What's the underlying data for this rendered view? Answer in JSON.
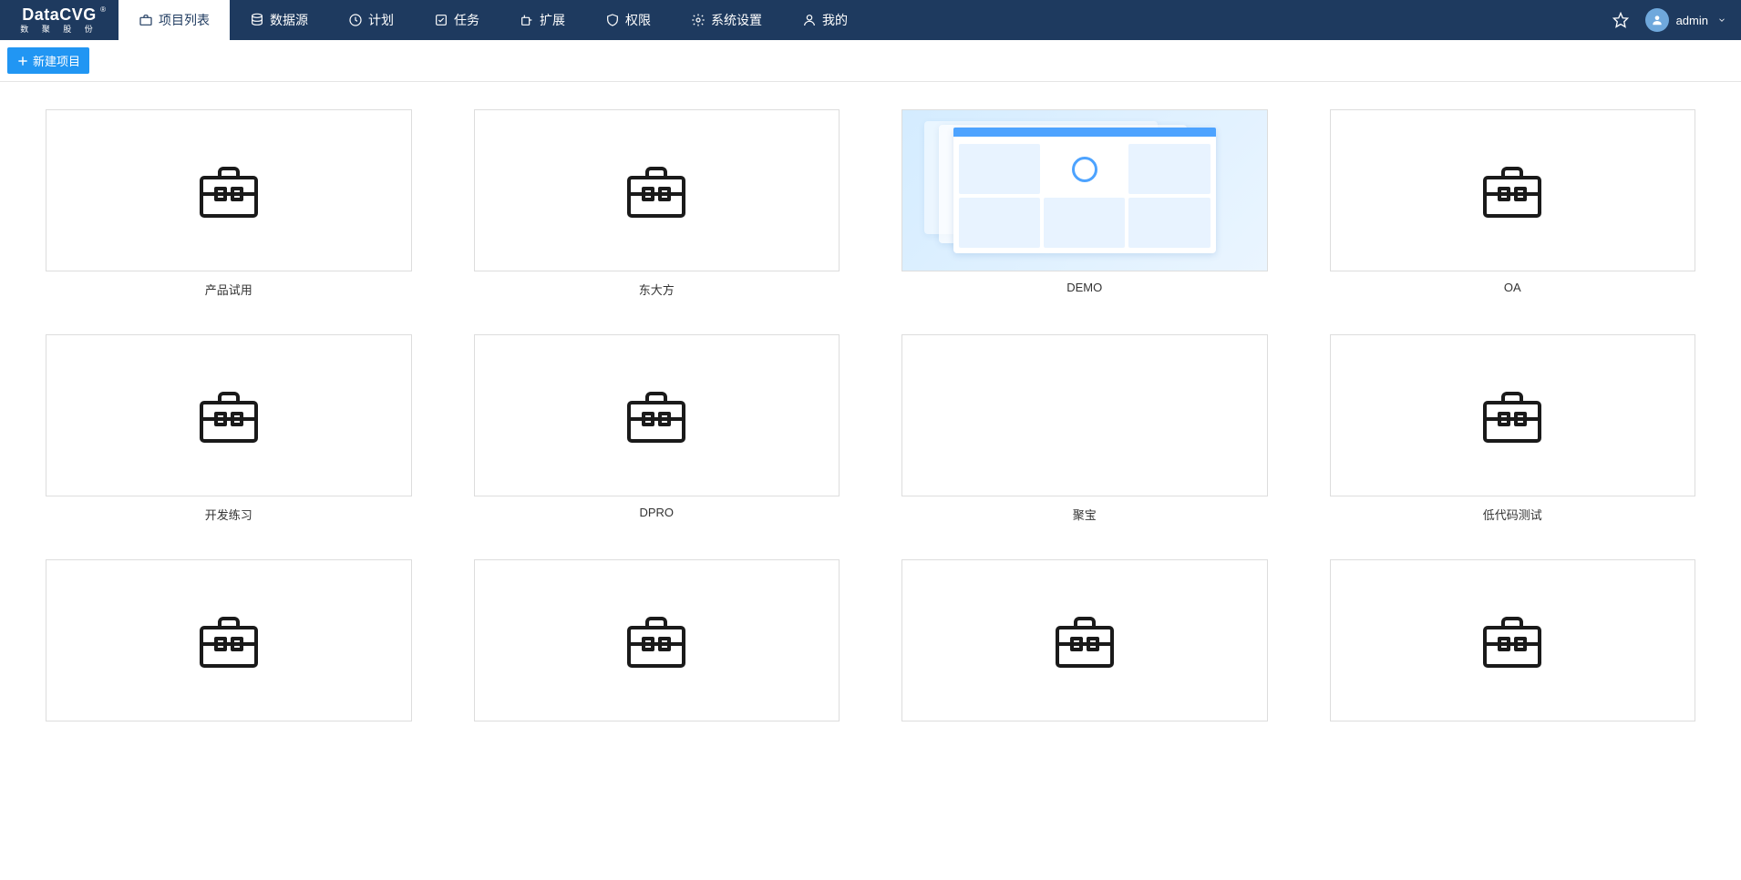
{
  "logo": {
    "main": "DataCVG",
    "sub": "数 聚 股 份",
    "reg": "®"
  },
  "nav": [
    {
      "label": "项目列表",
      "icon": "briefcase-icon",
      "active": true
    },
    {
      "label": "数据源",
      "icon": "database-icon",
      "active": false
    },
    {
      "label": "计划",
      "icon": "clock-icon",
      "active": false
    },
    {
      "label": "任务",
      "icon": "checklist-icon",
      "active": false
    },
    {
      "label": "扩展",
      "icon": "plugin-icon",
      "active": false
    },
    {
      "label": "权限",
      "icon": "shield-icon",
      "active": false
    },
    {
      "label": "系统设置",
      "icon": "gear-icon",
      "active": false
    },
    {
      "label": "我的",
      "icon": "user-icon",
      "active": false
    }
  ],
  "user": {
    "name": "admin"
  },
  "toolbar": {
    "new_project_label": "新建项目"
  },
  "projects": [
    {
      "title": "产品试用",
      "thumb": "default"
    },
    {
      "title": "东大方",
      "thumb": "default"
    },
    {
      "title": "DEMO",
      "thumb": "dashboard"
    },
    {
      "title": "OA",
      "thumb": "default"
    },
    {
      "title": "开发练习",
      "thumb": "default"
    },
    {
      "title": "DPRO",
      "thumb": "default"
    },
    {
      "title": "聚宝",
      "thumb": "blank"
    },
    {
      "title": "低代码测试",
      "thumb": "default"
    },
    {
      "title": "",
      "thumb": "default"
    },
    {
      "title": "",
      "thumb": "default"
    },
    {
      "title": "",
      "thumb": "default"
    },
    {
      "title": "",
      "thumb": "default"
    }
  ]
}
